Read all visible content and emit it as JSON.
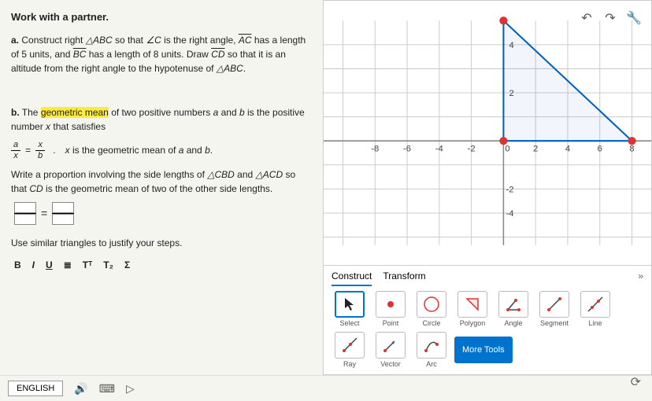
{
  "heading": "Work with a partner.",
  "partA": {
    "label": "a.",
    "t1": " Construct right ",
    "tri": "△ABC",
    "t2": " so that ",
    "ang": "∠C",
    "t3": " is the right angle, ",
    "ac": "AC",
    "t4": " has a length of 5 units, and ",
    "bc": "BC",
    "t5": " has a length of 8 units. Draw ",
    "cd": "CD",
    "t6": " so that it is an altitude from the right angle to the hypotenuse of ",
    "tri2": "△ABC",
    "t7": "."
  },
  "partB": {
    "label": "b.",
    "t1": " The ",
    "hl": "geometric mean",
    "t2": " of two positive numbers ",
    "a": "a",
    "t3": " and ",
    "b": "b",
    "t4": " is the positive number ",
    "x": "x",
    "t5": " that satisfies"
  },
  "ratio": {
    "a": "a",
    "x": "x",
    "b": "b",
    "desc_x": "x",
    "desc_rest": " is the geometric mean of ",
    "desc_a": "a",
    "desc_and": " and ",
    "desc_b": "b",
    "desc_end": "."
  },
  "write": {
    "t1": "Write a proportion involving the side lengths of ",
    "tri1": "△CBD",
    "t2": " and ",
    "tri2": "△ACD",
    "t3": " so that ",
    "cd": "CD",
    "t4": " is the geometric mean of two of the other side lengths."
  },
  "justify": "Use similar triangles to justify your steps.",
  "toolbar": {
    "b": "B",
    "i": "I",
    "u": "U",
    "list": "≣",
    "sup": "Tᵀ",
    "sub": "T₂",
    "sigma": "Σ"
  },
  "graph": {
    "xticks": [
      "-8",
      "-6",
      "-4",
      "-2",
      "0",
      "2",
      "4",
      "6",
      "8"
    ],
    "yticks_pos": [
      "2",
      "4"
    ],
    "yticks_neg": [
      "-2",
      "-4"
    ]
  },
  "tabs": {
    "construct": "Construct",
    "transform": "Transform"
  },
  "tools": {
    "select": "Select",
    "point": "Point",
    "circle": "Circle",
    "polygon": "Polygon",
    "angle": "Angle",
    "segment": "Segment",
    "line": "Line",
    "ray": "Ray",
    "vector": "Vector",
    "arc": "Arc",
    "more": "More Tools"
  },
  "bottom": {
    "lang": "ENGLISH"
  }
}
